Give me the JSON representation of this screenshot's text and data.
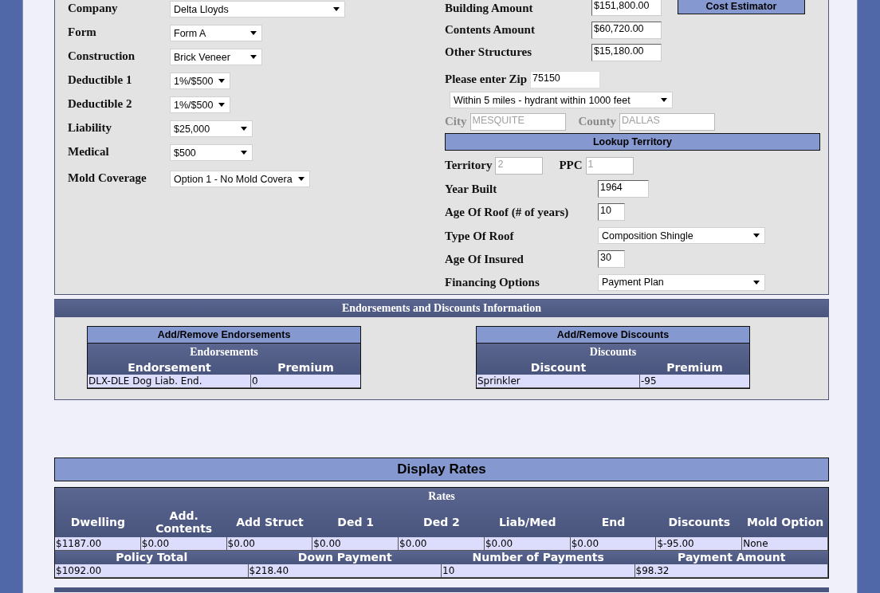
{
  "policy_fields": [
    {
      "label": "Company",
      "value": "Delta Lloyds"
    },
    {
      "label": "Form",
      "value": "Form A"
    },
    {
      "label": "Construction",
      "value": "Brick Veneer"
    },
    {
      "label": "Deductible 1",
      "value": "1%/$500"
    },
    {
      "label": "Deductible 2",
      "value": "1%/$500"
    },
    {
      "label": "Liability",
      "value": "$25,000"
    },
    {
      "label": "Medical",
      "value": "$500"
    },
    {
      "label": "Mold Coverage",
      "value": "Option 1 - No Mold Covera"
    }
  ],
  "amounts": [
    {
      "label": "Building Amount",
      "value": "$151,800.00"
    },
    {
      "label": "Contents Amount",
      "value": "$60,720.00"
    },
    {
      "label": "Other Structures",
      "value": "$15,180.00"
    }
  ],
  "cost_estimator_button": "Cost Estimator",
  "zip": {
    "label": "Please enter Zip",
    "value": "75150"
  },
  "protection_select": "Within 5 miles - hydrant within 1000 feet",
  "location_fields": [
    {
      "label": "City",
      "value": "MESQUITE",
      "disabled": true
    },
    {
      "label": "County",
      "value": "DALLAS",
      "disabled": true
    }
  ],
  "lookup_button": "Lookup Territory",
  "territory_fields": [
    {
      "label": "Territory",
      "value": "2",
      "disabled": true
    },
    {
      "label": "PPC",
      "value": "1",
      "disabled": true
    }
  ],
  "property_fields": [
    {
      "label": "Year Built",
      "value": "1964",
      "kind": "input"
    },
    {
      "label": "Age Of Roof (# of years)",
      "value": "10",
      "kind": "input"
    },
    {
      "label": "Type Of Roof",
      "value": "Composition Shingle",
      "kind": "select"
    },
    {
      "label": "Age Of Insured",
      "value": "30",
      "kind": "input"
    },
    {
      "label": "Financing Options",
      "value": "Payment Plan",
      "kind": "select"
    }
  ],
  "endorsements_section": {
    "title": "Endorsements and Discounts Information",
    "tables": [
      {
        "button": "Add/Remove Endorsements",
        "title": "Endorsements",
        "columns": [
          "Endorsement",
          "Premium"
        ],
        "rows": [
          [
            "DLX-DLE Dog Liab. End.",
            "0"
          ]
        ]
      },
      {
        "button": "Add/Remove Discounts",
        "title": "Discounts",
        "columns": [
          "Discount",
          "Premium"
        ],
        "rows": [
          [
            "Sprinkler",
            "-95"
          ]
        ]
      }
    ]
  },
  "display_rates": {
    "title": "Display Rates",
    "table_title": "Rates",
    "columns": [
      "Dwelling",
      "Add. Contents",
      "Add Struct",
      "Ded 1",
      "Ded 2",
      "Liab/Med",
      "End",
      "Discounts",
      "Mold Option"
    ],
    "row": [
      "$1187.00",
      "$0.00",
      "$0.00",
      "$0.00",
      "$0.00",
      "$0.00",
      "$0.00",
      "$-95.00",
      "None"
    ],
    "summary_columns": [
      "Policy Total",
      "Down Payment",
      "Number of Payments",
      "Payment Amount"
    ],
    "summary_row": [
      "$1092.00",
      "$218.40",
      "10",
      "$98.32"
    ]
  }
}
